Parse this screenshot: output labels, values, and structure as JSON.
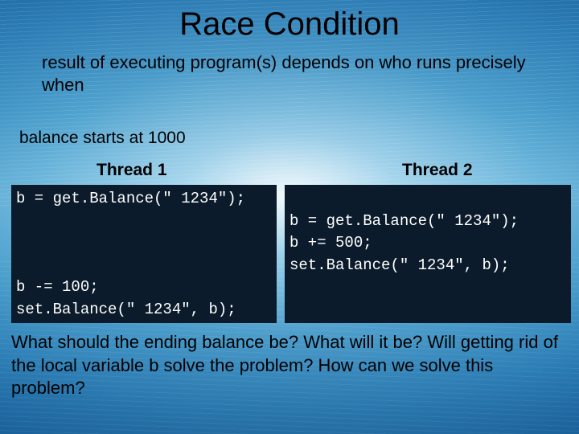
{
  "title": "Race Condition",
  "subtitle": "result of executing program(s) depends on who runs precisely when",
  "balance_line": "balance starts at 1000",
  "thread1_label": "Thread 1",
  "thread2_label": "Thread 2",
  "code1": "b = get.Balance(\" 1234\");\n\n\n\nb -= 100;\nset.Balance(\" 1234\", b);",
  "code2": "\nb = get.Balance(\" 1234\");\nb += 500;\nset.Balance(\" 1234\", b);",
  "questions": "What should the ending balance be?  What will it be?\nWill getting rid of the local variable b solve the problem?\nHow can we solve this problem?"
}
